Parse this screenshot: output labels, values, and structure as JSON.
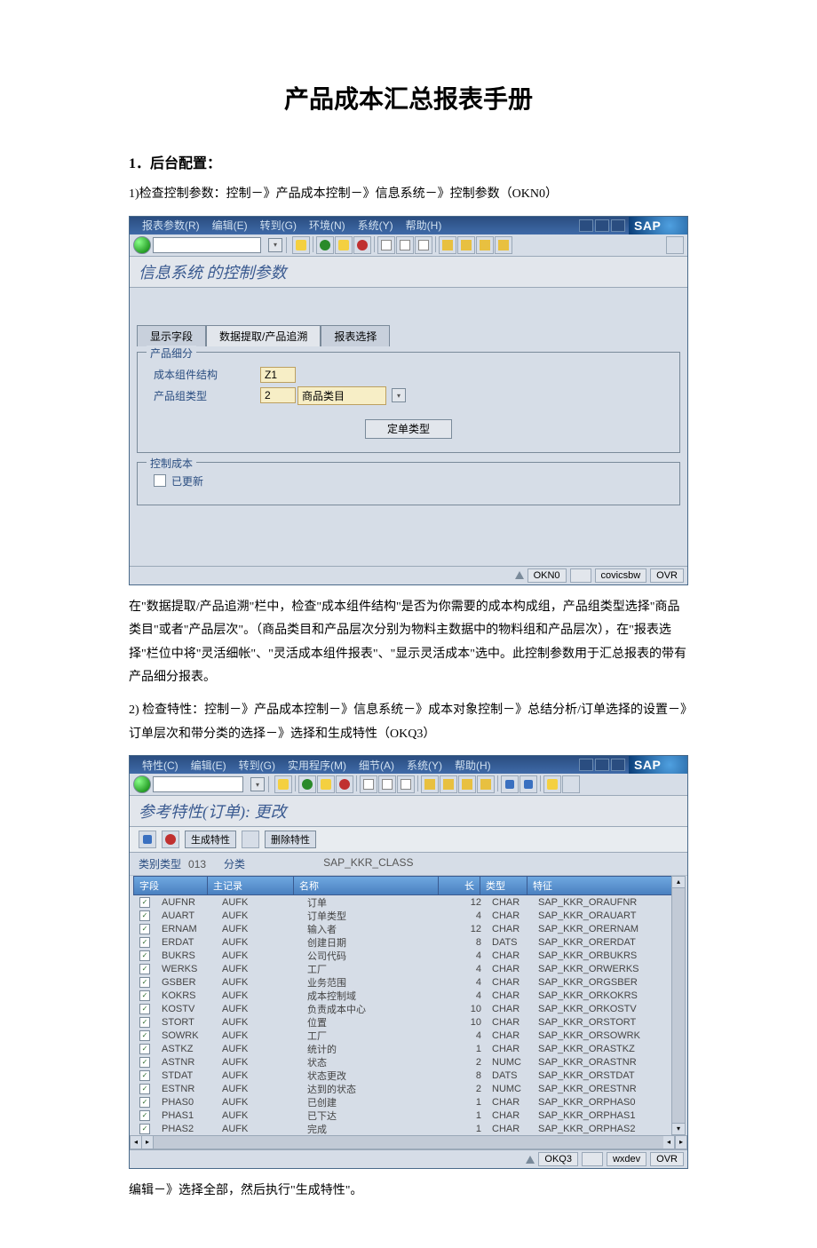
{
  "doc": {
    "title": "产品成本汇总报表手册",
    "h2_1": "1．后台配置：",
    "p1": "1)检查控制参数：控制－》产品成本控制－》信息系统－》控制参数（OKN0）",
    "p2": "在\"数据提取/产品追溯\"栏中，检查\"成本组件结构\"是否为你需要的成本构成组，产品组类型选择\"商品类目\"或者\"产品层次\"。（商品类目和产品层次分别为物料主数据中的物料组和产品层次），在\"报表选择\"栏位中将\"灵活细帐\"、\"灵活成本组件报表\"、\"显示灵活成本\"选中。此控制参数用于汇总报表的带有产品细分报表。",
    "p3": "2) 检查特性：控制－》产品成本控制－》信息系统－》成本对象控制－》总结分析/订单选择的设置－》订单层次和带分类的选择－》选择和生成特性（OKQ3）",
    "p4": "编辑－》选择全部，然后执行\"生成特性\"。"
  },
  "sap1": {
    "menus": [
      "报表参数(R)",
      "编辑(E)",
      "转到(G)",
      "环境(N)",
      "系统(Y)",
      "帮助(H)"
    ],
    "logo": "SAP",
    "subtitle": "信息系统    的控制参数",
    "tabs": {
      "t1": "显示字段",
      "t2": "数据提取/产品追溯",
      "t3": "报表选择"
    },
    "group1": {
      "legend": "产品细分",
      "r1_label": "成本组件结构",
      "r1_val": "Z1",
      "r2_label": "产品组类型",
      "r2_val": "2",
      "r2_txt": "商品类目",
      "btn": "定单类型"
    },
    "group2": {
      "legend": "控制成本",
      "chk": "已更新"
    },
    "status": {
      "tcode": "OKN0",
      "sys": "covicsbw",
      "mode": "OVR"
    }
  },
  "sap2": {
    "menus": [
      "特性(C)",
      "编辑(E)",
      "转到(G)",
      "实用程序(M)",
      "细节(A)",
      "系统(Y)",
      "帮助(H)"
    ],
    "logo": "SAP",
    "subtitle": "参考特性(订单):  更改",
    "actions": {
      "gen": "生成特性",
      "del": "删除特性"
    },
    "meta": {
      "k1": "类别类型",
      "v1": "013",
      "k2": "分类",
      "v2": "SAP_KKR_CLASS"
    },
    "hdr": {
      "fld": "字段",
      "rec": "主记录",
      "name": "名称",
      "len": "长",
      "type": "类型",
      "char": "特征"
    },
    "status": {
      "tcode": "OKQ3",
      "sys": "wxdev",
      "mode": "OVR"
    }
  },
  "chart_data": {
    "type": "table",
    "columns": [
      "字段",
      "主记录",
      "名称",
      "长",
      "类型",
      "特征"
    ],
    "rows": [
      {
        "checked": true,
        "fld": "AUFNR",
        "rec": "AUFK",
        "name": "订单",
        "len": 12,
        "type": "CHAR",
        "char": "SAP_KKR_ORAUFNR"
      },
      {
        "checked": true,
        "fld": "AUART",
        "rec": "AUFK",
        "name": "订单类型",
        "len": 4,
        "type": "CHAR",
        "char": "SAP_KKR_ORAUART"
      },
      {
        "checked": true,
        "fld": "ERNAM",
        "rec": "AUFK",
        "name": "输入者",
        "len": 12,
        "type": "CHAR",
        "char": "SAP_KKR_ORERNAM"
      },
      {
        "checked": true,
        "fld": "ERDAT",
        "rec": "AUFK",
        "name": "创建日期",
        "len": 8,
        "type": "DATS",
        "char": "SAP_KKR_ORERDAT"
      },
      {
        "checked": true,
        "fld": "BUKRS",
        "rec": "AUFK",
        "name": "公司代码",
        "len": 4,
        "type": "CHAR",
        "char": "SAP_KKR_ORBUKRS"
      },
      {
        "checked": true,
        "fld": "WERKS",
        "rec": "AUFK",
        "name": "工厂",
        "len": 4,
        "type": "CHAR",
        "char": "SAP_KKR_ORWERKS"
      },
      {
        "checked": true,
        "fld": "GSBER",
        "rec": "AUFK",
        "name": "业务范围",
        "len": 4,
        "type": "CHAR",
        "char": "SAP_KKR_ORGSBER"
      },
      {
        "checked": true,
        "fld": "KOKRS",
        "rec": "AUFK",
        "name": "成本控制域",
        "len": 4,
        "type": "CHAR",
        "char": "SAP_KKR_ORKOKRS"
      },
      {
        "checked": true,
        "fld": "KOSTV",
        "rec": "AUFK",
        "name": "负责成本中心",
        "len": 10,
        "type": "CHAR",
        "char": "SAP_KKR_ORKOSTV"
      },
      {
        "checked": true,
        "fld": "STORT",
        "rec": "AUFK",
        "name": "位置",
        "len": 10,
        "type": "CHAR",
        "char": "SAP_KKR_ORSTORT"
      },
      {
        "checked": true,
        "fld": "SOWRK",
        "rec": "AUFK",
        "name": "工厂",
        "len": 4,
        "type": "CHAR",
        "char": "SAP_KKR_ORSOWRK"
      },
      {
        "checked": true,
        "fld": "ASTKZ",
        "rec": "AUFK",
        "name": "统计的",
        "len": 1,
        "type": "CHAR",
        "char": "SAP_KKR_ORASTKZ"
      },
      {
        "checked": true,
        "fld": "ASTNR",
        "rec": "AUFK",
        "name": "状态",
        "len": 2,
        "type": "NUMC",
        "char": "SAP_KKR_ORASTNR"
      },
      {
        "checked": true,
        "fld": "STDAT",
        "rec": "AUFK",
        "name": "状态更改",
        "len": 8,
        "type": "DATS",
        "char": "SAP_KKR_ORSTDAT"
      },
      {
        "checked": true,
        "fld": "ESTNR",
        "rec": "AUFK",
        "name": "达到的状态",
        "len": 2,
        "type": "NUMC",
        "char": "SAP_KKR_ORESTNR"
      },
      {
        "checked": true,
        "fld": "PHAS0",
        "rec": "AUFK",
        "name": "已创建",
        "len": 1,
        "type": "CHAR",
        "char": "SAP_KKR_ORPHAS0"
      },
      {
        "checked": true,
        "fld": "PHAS1",
        "rec": "AUFK",
        "name": "已下达",
        "len": 1,
        "type": "CHAR",
        "char": "SAP_KKR_ORPHAS1"
      },
      {
        "checked": true,
        "fld": "PHAS2",
        "rec": "AUFK",
        "name": "完成",
        "len": 1,
        "type": "CHAR",
        "char": "SAP_KKR_ORPHAS2"
      }
    ]
  }
}
